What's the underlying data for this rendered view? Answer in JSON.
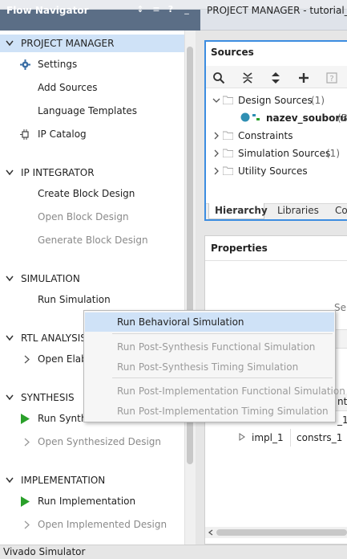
{
  "flow_navigator": {
    "title": "Flow Navigator",
    "header_buttons": {
      "collapse": "↕",
      "sort": "≡",
      "help": "?",
      "minimize": "_"
    },
    "sections": [
      {
        "label": "PROJECT MANAGER",
        "items": [
          "Settings",
          "Add Sources",
          "Language Templates",
          "IP Catalog"
        ]
      },
      {
        "label": "IP INTEGRATOR",
        "items": [
          "Create Block Design",
          "Open Block Design",
          "Generate Block Design"
        ]
      },
      {
        "label": "SIMULATION",
        "items": [
          "Run Simulation"
        ]
      },
      {
        "label": "RTL ANALYSIS",
        "items": [
          "Open Elab"
        ]
      },
      {
        "label": "SYNTHESIS",
        "items": [
          "Run Synth",
          "Open Synthesized Design"
        ]
      },
      {
        "label": "IMPLEMENTATION",
        "items": [
          "Run Implementation",
          "Open Implemented Design"
        ]
      }
    ]
  },
  "project_manager": {
    "title": "PROJECT MANAGER - tutorial_",
    "sources": {
      "title": "Sources",
      "tree": [
        {
          "label": "Design Sources",
          "count": "(1)"
        },
        {
          "label": "nazev_souboru",
          "suffix": "(B"
        },
        {
          "label": "Constraints",
          "count": ""
        },
        {
          "label": "Simulation Sources",
          "count": "(1)"
        },
        {
          "label": "Utility Sources",
          "count": ""
        }
      ],
      "tabs": [
        "Hierarchy",
        "Libraries",
        "Co"
      ]
    },
    "properties": {
      "title": "Properties",
      "hint": "Se",
      "partial_cells": [
        "nts",
        "_1"
      ],
      "run_row": {
        "name": "impl_1",
        "constraints": "constrs_1"
      }
    }
  },
  "context_menu": {
    "items": [
      {
        "label": "Run Behavioral Simulation",
        "enabled": true
      },
      {
        "label": "Run Post-Synthesis Functional Simulation",
        "enabled": false
      },
      {
        "label": "Run Post-Synthesis Timing Simulation",
        "enabled": false
      },
      {
        "label": "Run Post-Implementation Functional Simulation",
        "enabled": false
      },
      {
        "label": "Run Post-Implementation Timing Simulation",
        "enabled": false
      }
    ]
  },
  "status_bar": {
    "text": "Vivado Simulator"
  },
  "colors": {
    "header_bg": "#5b6e86",
    "selected_row": "#cfe2f7",
    "accent_blue": "#3c8de0",
    "run_green": "#2aa02a"
  }
}
